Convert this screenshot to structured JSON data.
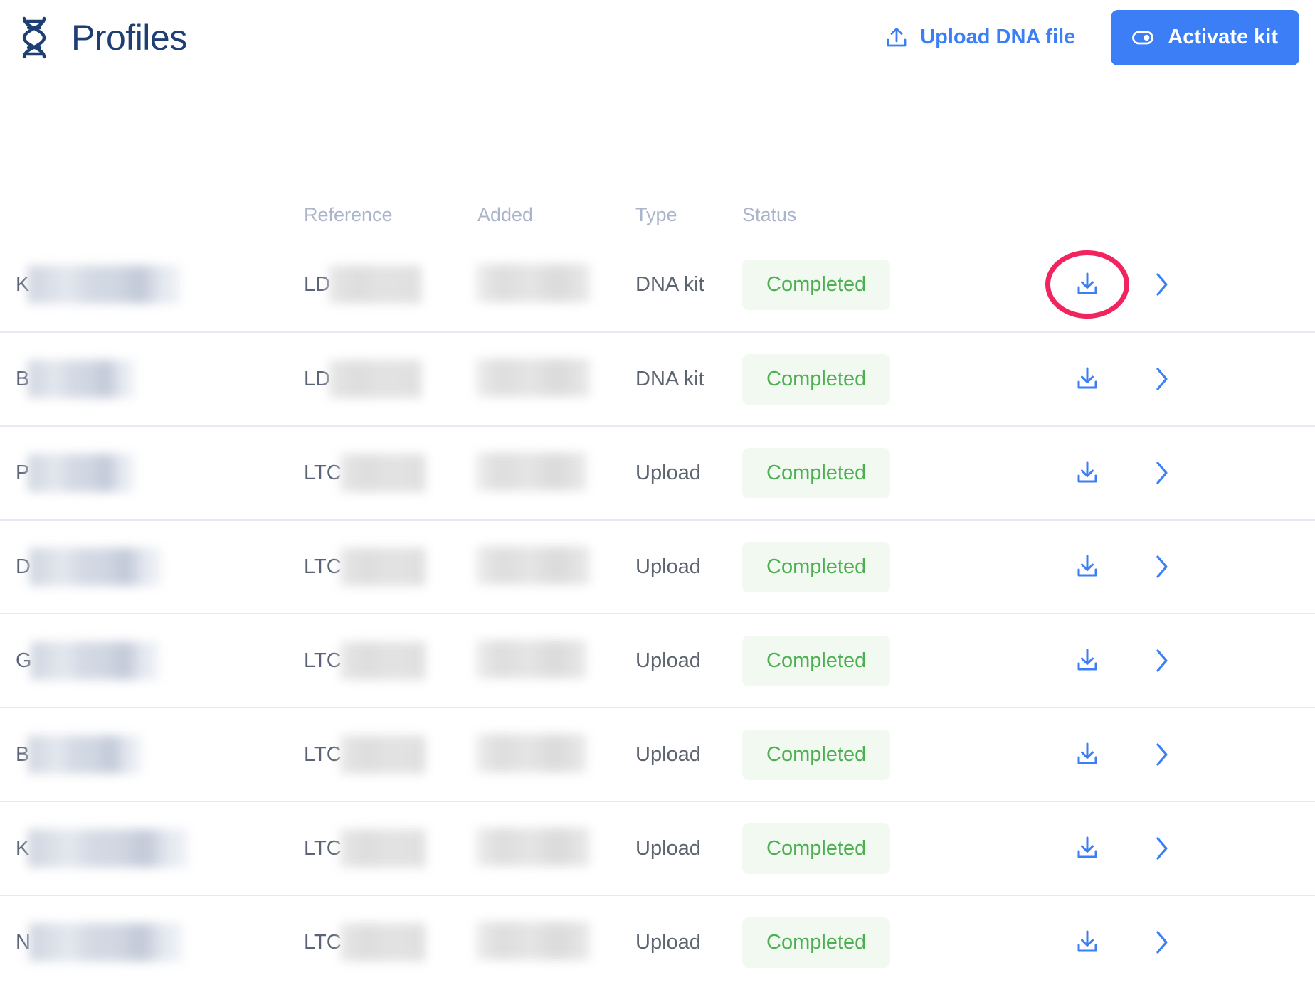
{
  "header": {
    "logo_icon": "dna-helix-icon",
    "title": "Profiles",
    "upload_link": {
      "icon": "upload-icon",
      "label": "Upload DNA file"
    },
    "activate_button": {
      "icon": "kit-toggle-icon",
      "label": "Activate kit"
    }
  },
  "table": {
    "columns": [
      "",
      "Reference",
      "Added",
      "Type",
      "Status",
      "",
      ""
    ],
    "headers": {
      "name": "",
      "reference": "Reference",
      "added": "Added",
      "type": "Type",
      "status": "Status"
    },
    "row_actions": {
      "download_icon": "download-icon",
      "chevron_icon": "chevron-right-icon"
    },
    "rows": [
      {
        "name_visible": "K",
        "name_redacted": true,
        "reference_visible": "LD",
        "reference_redacted": true,
        "added_redacted": true,
        "type": "DNA kit",
        "status": "Completed"
      },
      {
        "name_visible": "B",
        "name_redacted": true,
        "reference_visible": "LD",
        "reference_redacted": true,
        "added_redacted": true,
        "type": "DNA kit",
        "status": "Completed"
      },
      {
        "name_visible": "P",
        "name_redacted": true,
        "reference_visible": "LTC",
        "reference_redacted": true,
        "added_redacted": true,
        "type": "Upload",
        "status": "Completed"
      },
      {
        "name_visible": "D",
        "name_redacted": true,
        "reference_visible": "LTC",
        "reference_redacted": true,
        "added_redacted": true,
        "type": "Upload",
        "status": "Completed"
      },
      {
        "name_visible": "G",
        "name_redacted": true,
        "reference_visible": "LTC",
        "reference_redacted": true,
        "added_redacted": true,
        "type": "Upload",
        "status": "Completed"
      },
      {
        "name_visible": "B",
        "name_redacted": true,
        "reference_visible": "LTC",
        "reference_redacted": true,
        "added_redacted": true,
        "type": "Upload",
        "status": "Completed"
      },
      {
        "name_visible": "K",
        "name_redacted": true,
        "reference_visible": "LTC",
        "reference_redacted": true,
        "added_redacted": true,
        "type": "Upload",
        "status": "Completed"
      },
      {
        "name_visible": "N",
        "name_redacted": true,
        "reference_visible": "LTC",
        "reference_redacted": true,
        "added_redacted": true,
        "type": "Upload",
        "status": "Completed"
      }
    ]
  },
  "annotation": {
    "shape": "ellipse",
    "color": "#f0245e",
    "target": "download-icon-row-1"
  },
  "colors": {
    "brand_blue": "#3b7ef5",
    "title_navy": "#1e3f73",
    "status_green": "#4caf50",
    "status_green_bg": "#f1f9f1",
    "header_grey": "#aab4cb",
    "text_grey": "#5c6470",
    "divider": "#e6eaf4",
    "annotation_pink": "#f0245e"
  }
}
